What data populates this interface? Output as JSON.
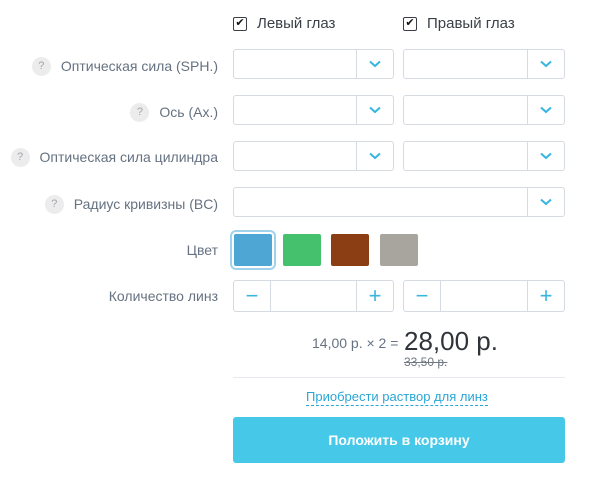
{
  "eyes": {
    "left_label": "Левый глаз",
    "left_checked": true,
    "right_label": "Правый глаз",
    "right_checked": true
  },
  "rows": {
    "sph": {
      "label": "Оптическая сила (SPH.)",
      "help": "?"
    },
    "axis": {
      "label": "Ось (Ax.)",
      "help": "?"
    },
    "cyl": {
      "label": "Оптическая сила цилиндра",
      "help": "?"
    },
    "bc": {
      "label": "Радиус кривизны (BC)",
      "help": "?"
    }
  },
  "color": {
    "label": "Цвет",
    "swatches": [
      "#4da6d3",
      "#45c06d",
      "#8b3e14",
      "#a8a59e"
    ],
    "selected_index": 0
  },
  "quantity": {
    "label": "Количество линз",
    "minus": "−",
    "plus": "+"
  },
  "price": {
    "unit_formula": "14,00 р. × 2 =",
    "total": "28,00 р.",
    "old": "33,50 р."
  },
  "solution_link": "Приобрести раствор для линз",
  "cart_button": "Положить в корзину",
  "colors": {
    "accent": "#37b6e0",
    "button": "#46c9e9"
  }
}
